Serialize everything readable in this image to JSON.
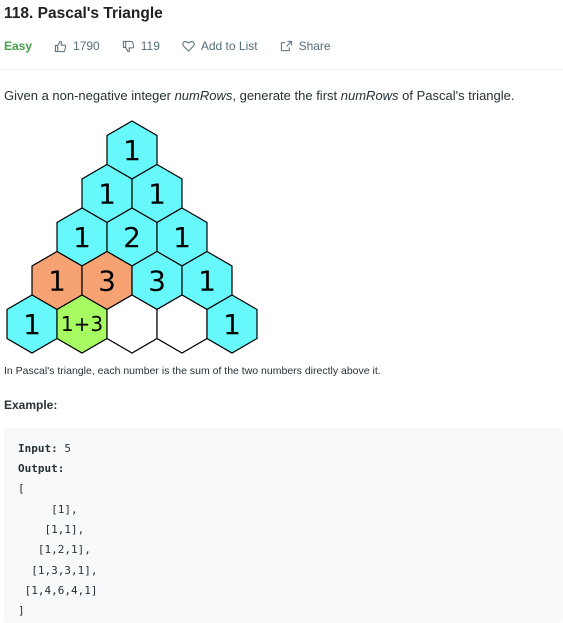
{
  "problem": {
    "title": "118. Pascal's Triangle",
    "difficulty": "Easy",
    "likes": "1790",
    "dislikes": "119",
    "add_to_list": "Add to List",
    "share": "Share"
  },
  "description": {
    "before": "Given a non-negative integer ",
    "var1": "numRows",
    "middle": ", generate the first ",
    "var2": "numRows",
    "after": " of Pascal's triangle."
  },
  "figure": {
    "cells": [
      "1",
      "1",
      "1",
      "1",
      "2",
      "1",
      "1",
      "3",
      "3",
      "1",
      "1",
      "1+3",
      "",
      "",
      "1"
    ],
    "colors": {
      "cyan": "#66f8fa",
      "orange": "#f7a273",
      "green": "#a6fb63",
      "empty": "#ffffff",
      "stroke": "#000000"
    }
  },
  "caption": "In Pascal's triangle, each number is the sum of the two numbers directly above it.",
  "example": {
    "heading": "Example:",
    "input_label": "Input:",
    "input_value": " 5",
    "output_label": "Output:",
    "lines": [
      "[",
      "     [1],",
      "    [1,1],",
      "   [1,2,1],",
      "  [1,3,3,1],",
      " [1,4,6,4,1]",
      "]"
    ]
  }
}
